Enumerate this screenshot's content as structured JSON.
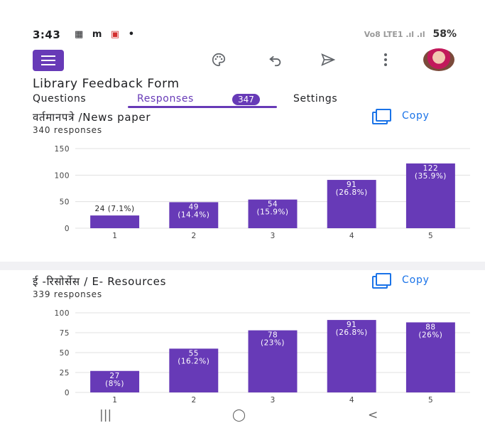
{
  "status": {
    "time": "3:43",
    "icons": [
      "▦",
      "m",
      "▣",
      "•"
    ],
    "signal": "Vo8 LTE1 .ıl .ıl",
    "battery": "58%"
  },
  "toolbar": {
    "icons": [
      "palette-icon",
      "undo-icon",
      "send-icon",
      "more-vert-icon"
    ]
  },
  "form": {
    "title": "Library Feedback Form"
  },
  "tabs": [
    {
      "label": "Questions"
    },
    {
      "label": "Responses",
      "badge": "347"
    },
    {
      "label": "Settings"
    }
  ],
  "questions": [
    {
      "title": "वर्तमानपत्रे /News paper",
      "count": "340 responses",
      "copy_label": "Copy",
      "chart_data": {
        "type": "bar",
        "categories": [
          "1",
          "2",
          "3",
          "4",
          "5"
        ],
        "values": [
          24,
          49,
          54,
          91,
          122
        ],
        "labels": [
          "24 (7.1%)",
          "49 (14.4%)",
          "54 (15.9%)",
          "91 (26.8%)",
          "122 (35.9%)"
        ],
        "yticks": [
          "0",
          "50",
          "100",
          "150"
        ],
        "ylim": [
          0,
          150
        ],
        "color": "#673ab7"
      }
    },
    {
      "title": "ई -रिसोर्सेस / E- Resources",
      "count": "339 responses",
      "copy_label": "Copy",
      "chart_data": {
        "type": "bar",
        "categories": [
          "1",
          "2",
          "3",
          "4",
          "5"
        ],
        "values": [
          27,
          55,
          78,
          91,
          88
        ],
        "labels": [
          "27 (8%)",
          "55 (16.2%)",
          "78 (23%)",
          "91 (26.8%)",
          "88 (26%)"
        ],
        "yticks": [
          "0",
          "25",
          "50",
          "75",
          "100"
        ],
        "ylim": [
          0,
          100
        ],
        "color": "#673ab7"
      }
    }
  ],
  "nav": {
    "recents": "|||",
    "home": "◯",
    "back": "<"
  }
}
